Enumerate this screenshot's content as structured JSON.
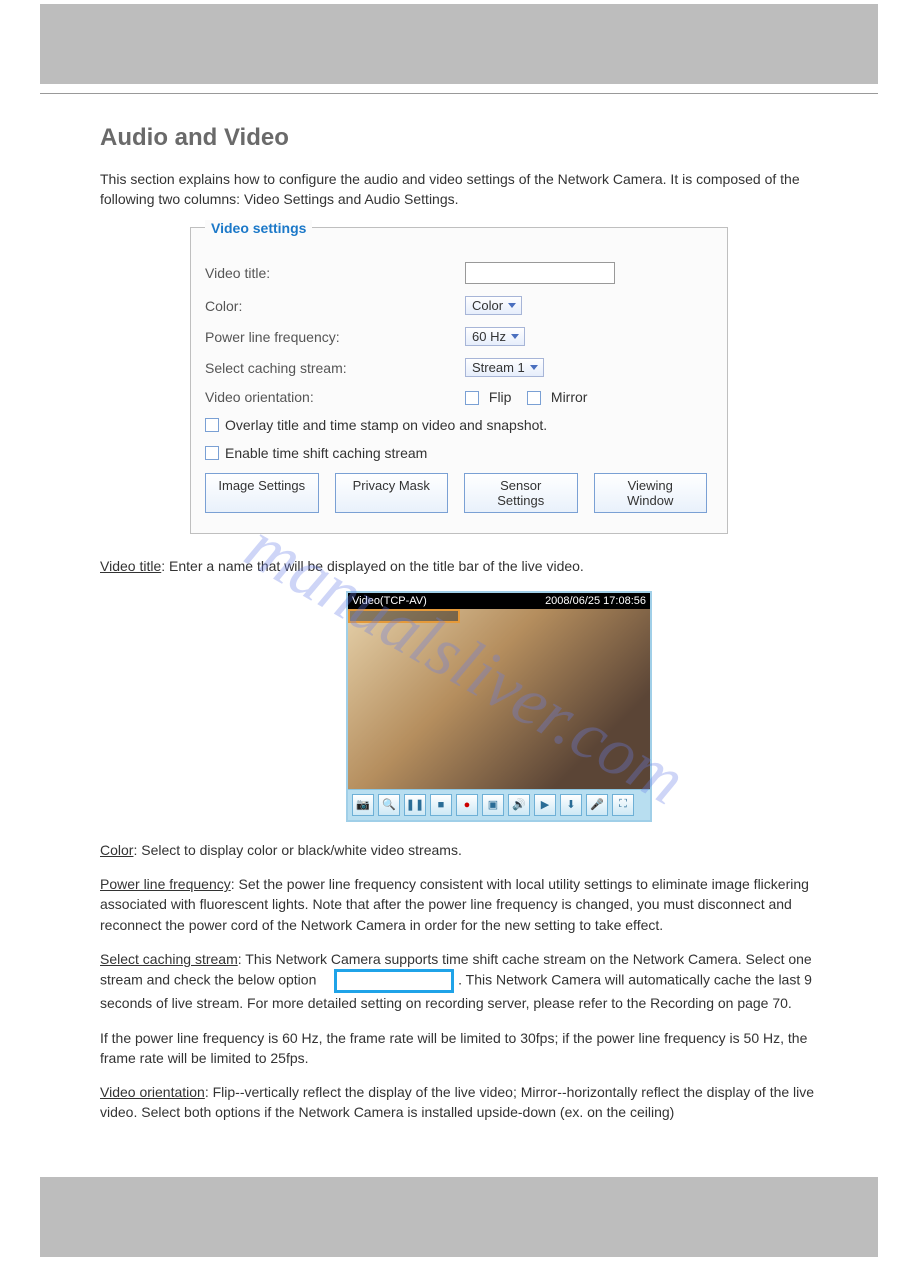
{
  "section": {
    "title": "Audio and Video",
    "intro": "This section explains how to configure the audio and video settings of the Network Camera. It is composed of the following two columns: Video Settings and Audio Settings."
  },
  "videoSettings": {
    "legend": "Video settings",
    "labels": {
      "videoTitle": "Video title:",
      "color": "Color:",
      "powerLine": "Power line frequency:",
      "cachingStream": "Select caching stream:",
      "orientation": "Video orientation:",
      "flip": "Flip",
      "mirror": "Mirror",
      "overlay": "Overlay title and time stamp on video and snapshot.",
      "timeshift": "Enable time shift caching stream"
    },
    "values": {
      "color": "Color",
      "powerLine": "60 Hz",
      "cachingStream": "Stream 1"
    },
    "buttons": {
      "image": "Image Settings",
      "privacy": "Privacy Mask",
      "sensor": "Sensor Settings",
      "viewing": "Viewing Window"
    }
  },
  "preview": {
    "videoLabel": "Video(TCP-AV)",
    "timestamp": "2008/06/25 17:08:56",
    "toolbarIcons": [
      "camera-icon",
      "zoom-icon",
      "pause-icon",
      "stop-icon",
      "record-icon",
      "snapshot-icon",
      "volume-icon",
      "save-icon",
      "download-icon",
      "mic-icon",
      "fullscreen-icon"
    ]
  },
  "fields": {
    "videoTitle": {
      "heading": "Video title",
      "text": ": Enter a name that will be displayed on the title bar of the live video."
    },
    "color": {
      "heading": "Color",
      "text": ": Select to display color or black/white video streams."
    },
    "powerLine": {
      "heading": "Power line frequency",
      "text": ": Set the power line frequency consistent with local utility settings to eliminate image flickering associated with fluorescent lights. Note that after the power line frequency is changed, you must disconnect and reconnect the power cord of the Network Camera in order for the new setting to take effect."
    },
    "caching": {
      "heading": "Select caching stream",
      "text": ": This Network Camera supports time shift cache stream on the Network Camera. Select one stream and check the below option ",
      "badgeNote": "Enable time shift caching stream",
      "after": ". This Network Camera will automatically cache the last 9 seconds of live stream. For more detailed setting on recording server, please refer to the Recording on page 70."
    },
    "tip": "If the power line frequency is 60 Hz, the frame rate will be limited to 30fps; if the power line frequency is 50 Hz, the frame rate will be limited to 25fps.",
    "orientation": {
      "heading": "Video orientation",
      "text": ": Flip--vertically reflect the display of the live video; Mirror--horizontally reflect the display of the live video. Select both options if the Network Camera is installed upside-down (ex. on the ceiling)"
    }
  }
}
